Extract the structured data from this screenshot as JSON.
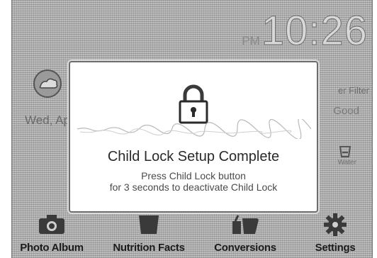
{
  "clock": {
    "ampm": "PM",
    "time": "10:26"
  },
  "home": {
    "date": "Wed, Ap",
    "filter_label": "er Filter",
    "filter_status": "Good",
    "water_label": "Water"
  },
  "dialog": {
    "title": "Child Lock Setup Complete",
    "message_line1": "Press Child Lock button",
    "message_line2": "for 3 seconds to deactivate Child Lock"
  },
  "nav": {
    "items": [
      {
        "label": "Photo Album",
        "icon": "camera-icon"
      },
      {
        "label": "Nutrition Facts",
        "icon": "nutrition-icon"
      },
      {
        "label": "Conversions",
        "icon": "conversions-icon"
      },
      {
        "label": "Settings",
        "icon": "gear-icon"
      }
    ]
  },
  "colors": {
    "screen_bg": "#bdbdbd",
    "dialog_bg": "#ffffff",
    "text_dark": "#2a2a2a"
  }
}
